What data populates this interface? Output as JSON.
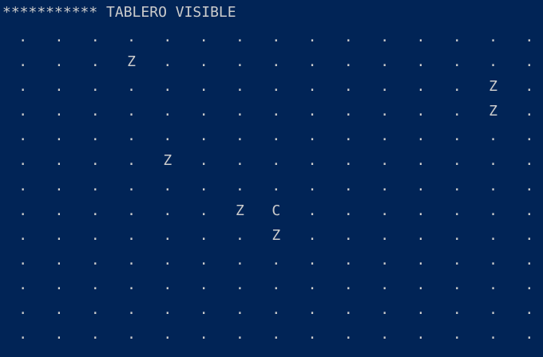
{
  "console": {
    "header_text": "*********** TABLERO VISIBLE",
    "background_color": "#012456",
    "text_color": "#cccccc"
  },
  "board": {
    "rows": [
      [
        ".",
        ".",
        ".",
        ".",
        ".",
        ".",
        ".",
        ".",
        ".",
        ".",
        ".",
        ".",
        ".",
        ".",
        "."
      ],
      [
        ".",
        ".",
        ".",
        "Z",
        ".",
        ".",
        ".",
        ".",
        ".",
        ".",
        ".",
        ".",
        ".",
        ".",
        "."
      ],
      [
        ".",
        ".",
        ".",
        ".",
        ".",
        ".",
        ".",
        ".",
        ".",
        ".",
        ".",
        ".",
        ".",
        "Z",
        "."
      ],
      [
        ".",
        ".",
        ".",
        ".",
        ".",
        ".",
        ".",
        ".",
        ".",
        ".",
        ".",
        ".",
        ".",
        "Z",
        "."
      ],
      [
        ".",
        ".",
        ".",
        ".",
        ".",
        ".",
        ".",
        ".",
        ".",
        ".",
        ".",
        ".",
        ".",
        ".",
        "."
      ],
      [
        ".",
        ".",
        ".",
        ".",
        "Z",
        ".",
        ".",
        ".",
        ".",
        ".",
        ".",
        ".",
        ".",
        ".",
        "."
      ],
      [
        ".",
        ".",
        ".",
        ".",
        ".",
        ".",
        ".",
        ".",
        ".",
        ".",
        ".",
        ".",
        ".",
        ".",
        "."
      ],
      [
        ".",
        ".",
        ".",
        ".",
        ".",
        ".",
        "Z",
        "C",
        ".",
        ".",
        ".",
        ".",
        ".",
        ".",
        "."
      ],
      [
        ".",
        ".",
        ".",
        ".",
        ".",
        ".",
        ".",
        "Z",
        ".",
        ".",
        ".",
        ".",
        ".",
        ".",
        "."
      ],
      [
        ".",
        ".",
        ".",
        ".",
        ".",
        ".",
        ".",
        ".",
        ".",
        ".",
        ".",
        ".",
        ".",
        ".",
        "."
      ],
      [
        ".",
        ".",
        ".",
        ".",
        ".",
        ".",
        ".",
        ".",
        ".",
        ".",
        ".",
        ".",
        ".",
        ".",
        "."
      ],
      [
        ".",
        ".",
        ".",
        ".",
        ".",
        ".",
        ".",
        ".",
        ".",
        ".",
        ".",
        ".",
        ".",
        ".",
        "."
      ],
      [
        ".",
        ".",
        ".",
        ".",
        ".",
        ".",
        ".",
        ".",
        ".",
        ".",
        ".",
        ".",
        ".",
        ".",
        "."
      ]
    ]
  }
}
